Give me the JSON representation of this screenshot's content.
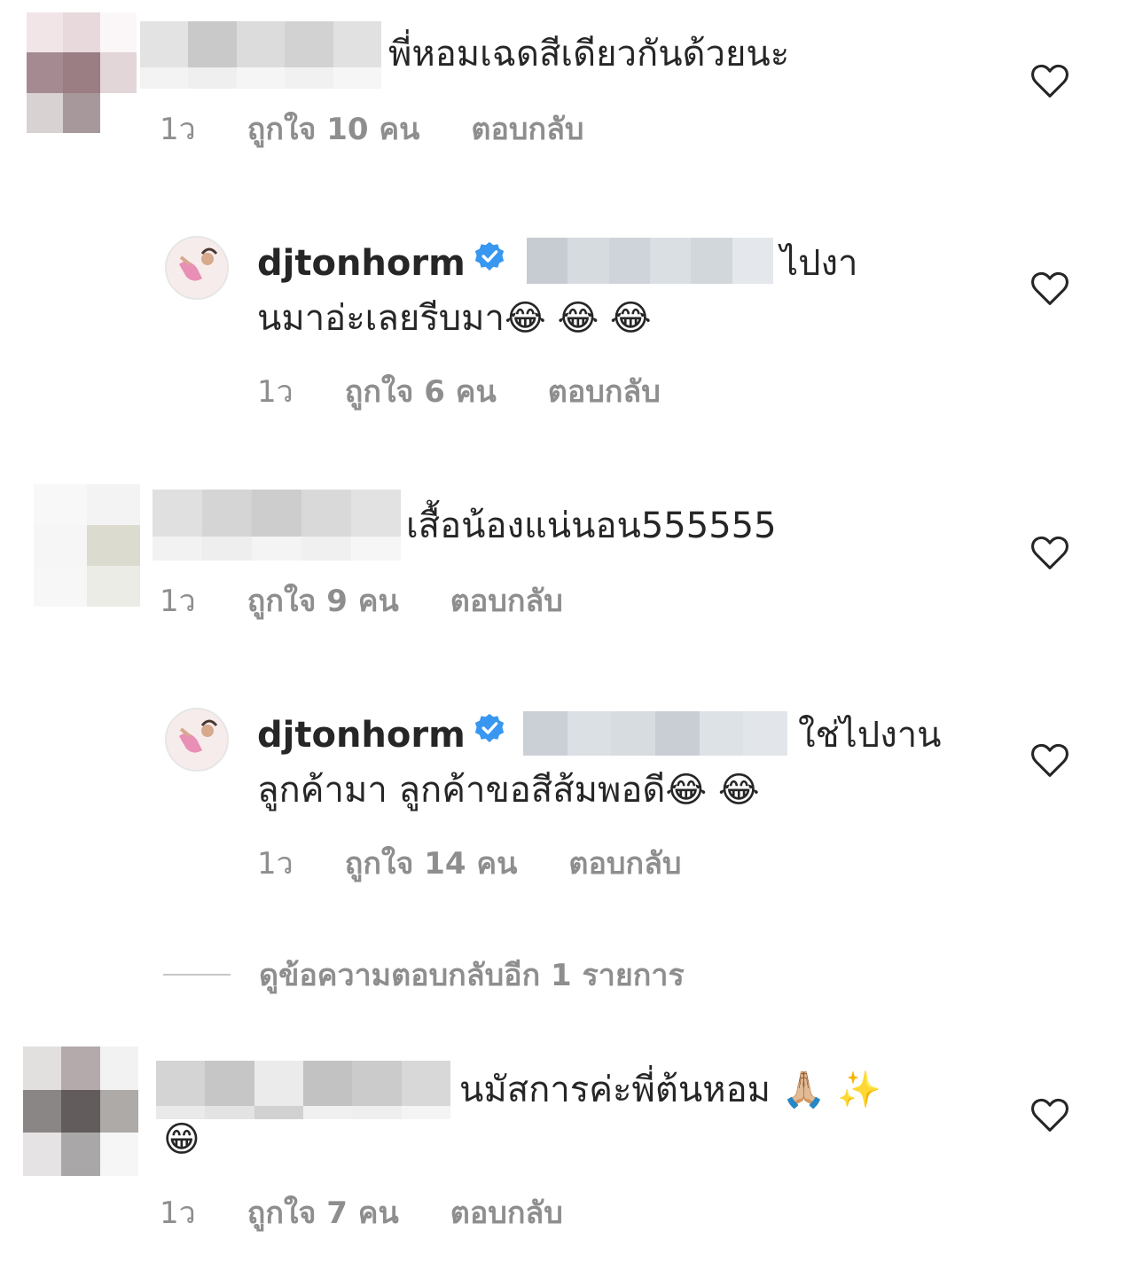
{
  "colors": {
    "secondary_text": "#8e8e8e",
    "primary_text": "#262626",
    "verified": "#3897f0"
  },
  "comments": [
    {
      "text": "พี่หอมเฉดสีเดียวกันด้วยนะ",
      "time": "1ว",
      "likes": "ถูกใจ 10 คน",
      "reply": "ตอบกลับ"
    },
    {
      "username": "djtonhorm",
      "line1": "ไปงา",
      "line2": "นมาอ่ะเลยรีบมา",
      "emoji": "😂 😂 😂",
      "time": "1ว",
      "likes": "ถูกใจ 6 คน",
      "reply": "ตอบกลับ"
    },
    {
      "text": "เสื้อน้องแน่นอน555555",
      "time": "1ว",
      "likes": "ถูกใจ 9 คน",
      "reply": "ตอบกลับ"
    },
    {
      "username": "djtonhorm",
      "line1": "ใช่ไปงาน",
      "line2": "ลูกค้ามา ลูกค้าขอสีส้มพอดี",
      "emoji": "😂 😂",
      "time": "1ว",
      "likes": "ถูกใจ 14 คน",
      "reply": "ตอบกลับ"
    },
    {
      "text": "นมัสการค่ะพี่ต้นหอม",
      "emoji1": "🙏🏼 ✨",
      "emoji2": "😁",
      "time": "1ว",
      "likes": "ถูกใจ 7 คน",
      "reply": "ตอบกลับ"
    }
  ],
  "view_more_replies": "ดูข้อความตอบกลับอีก 1 รายการ",
  "icons": {
    "like": "heart-icon",
    "verified": "verified-badge-icon"
  }
}
